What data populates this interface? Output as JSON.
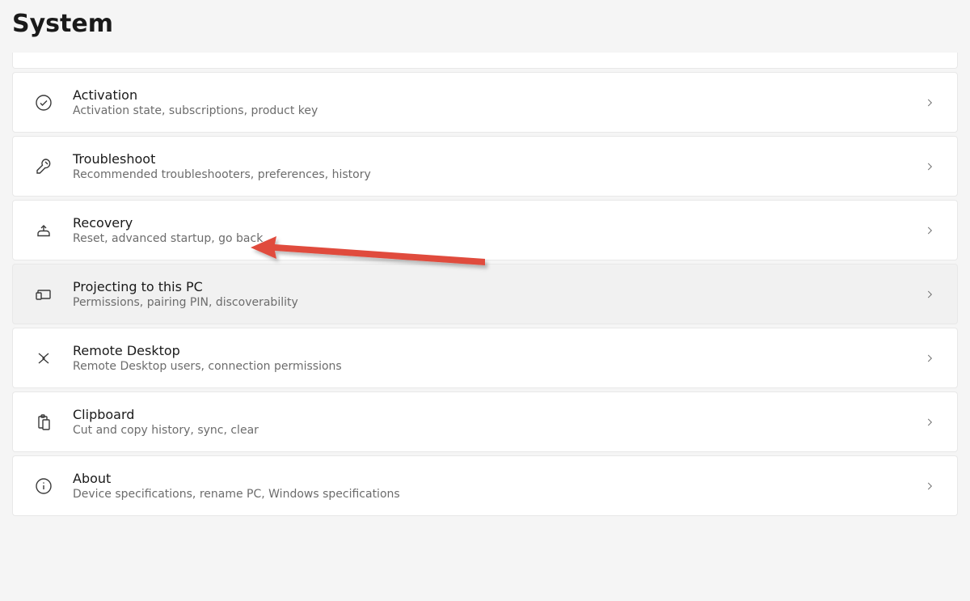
{
  "pageTitle": "System",
  "rows": [
    {
      "icon": "check",
      "title": "Activation",
      "desc": "Activation state, subscriptions, product key",
      "disabled": false
    },
    {
      "icon": "wrench",
      "title": "Troubleshoot",
      "desc": "Recommended troubleshooters, preferences, history",
      "disabled": false
    },
    {
      "icon": "recovery",
      "title": "Recovery",
      "desc": "Reset, advanced startup, go back",
      "disabled": false
    },
    {
      "icon": "project",
      "title": "Projecting to this PC",
      "desc": "Permissions, pairing PIN, discoverability",
      "disabled": true
    },
    {
      "icon": "remote",
      "title": "Remote Desktop",
      "desc": "Remote Desktop users, connection permissions",
      "disabled": false
    },
    {
      "icon": "clipboard",
      "title": "Clipboard",
      "desc": "Cut and copy history, sync, clear",
      "disabled": false
    },
    {
      "icon": "info",
      "title": "About",
      "desc": "Device specifications, rename PC, Windows specifications",
      "disabled": false
    }
  ],
  "annotation": {
    "arrowColor": "#e04b3d"
  }
}
